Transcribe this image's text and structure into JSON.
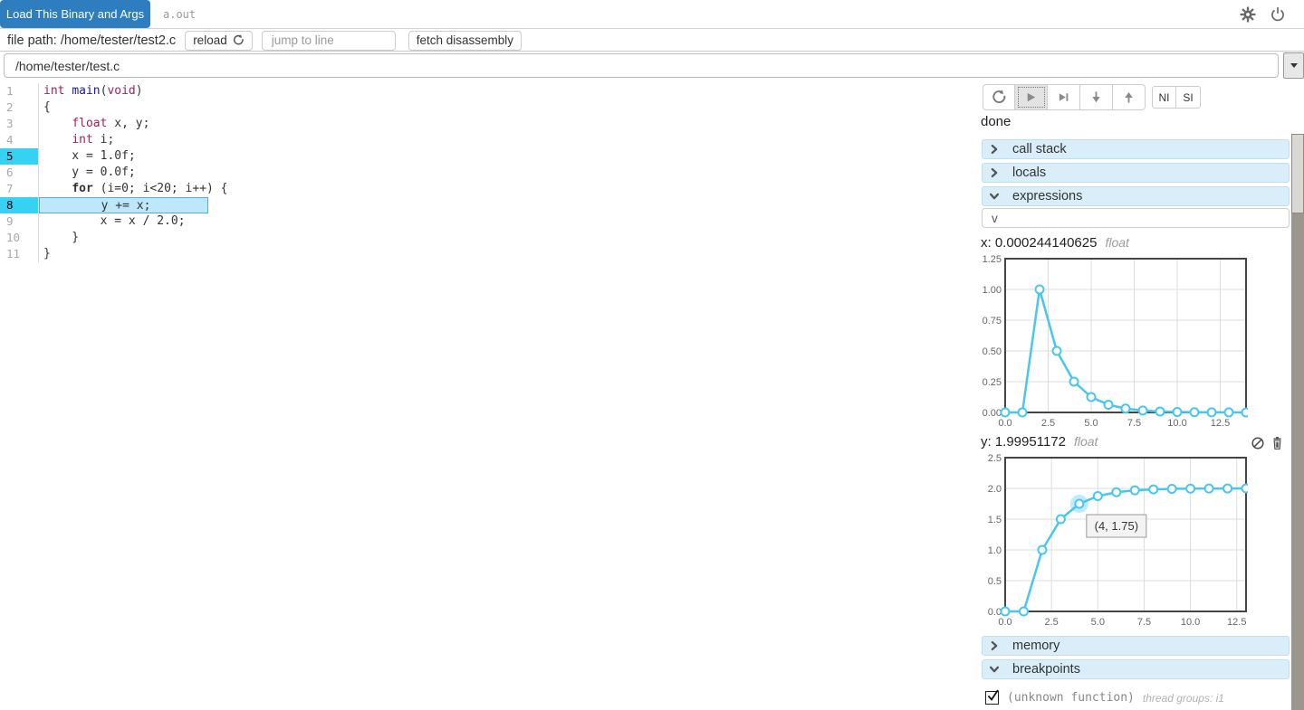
{
  "toolbar": {
    "load_button_label": "Load This Binary and Args",
    "binary_value": "a.out"
  },
  "file_bar": {
    "path_label": "file path: /home/tester/test2.c",
    "reload_button_label": "reload",
    "jump_placeholder": "jump to line",
    "fetch_button_label": "fetch disassembly"
  },
  "source_select": {
    "value": "/home/tester/test.c"
  },
  "editor": {
    "lines": [
      {
        "num": 1,
        "tokens": [
          {
            "t": "int",
            "c": "k"
          },
          {
            "t": " ",
            "c": "p"
          },
          {
            "t": "main",
            "c": "f"
          },
          {
            "t": "(",
            "c": "p"
          },
          {
            "t": "void",
            "c": "k"
          },
          {
            "t": ")",
            "c": "p"
          }
        ]
      },
      {
        "num": 2,
        "tokens": [
          {
            "t": "{",
            "c": "p"
          }
        ]
      },
      {
        "num": 3,
        "tokens": [
          {
            "t": "    ",
            "c": "p"
          },
          {
            "t": "float",
            "c": "k"
          },
          {
            "t": " x, y;",
            "c": "p"
          }
        ]
      },
      {
        "num": 4,
        "tokens": [
          {
            "t": "    ",
            "c": "p"
          },
          {
            "t": "int",
            "c": "k"
          },
          {
            "t": " i;",
            "c": "p"
          }
        ]
      },
      {
        "num": 5,
        "gutter_active": true,
        "tokens": [
          {
            "t": "    x = 1.0f;",
            "c": "p"
          }
        ]
      },
      {
        "num": 6,
        "tokens": [
          {
            "t": "    y = 0.0f;",
            "c": "p"
          }
        ]
      },
      {
        "num": 7,
        "tokens": [
          {
            "t": "    ",
            "c": "p"
          },
          {
            "t": "for",
            "c": "b"
          },
          {
            "t": " (i=0; i<20; i++) {",
            "c": "p"
          }
        ]
      },
      {
        "num": 8,
        "gutter_active": true,
        "line_active": true,
        "tokens": [
          {
            "t": "        y += x;",
            "c": "p"
          }
        ]
      },
      {
        "num": 9,
        "tokens": [
          {
            "t": "        x = x / 2.0;",
            "c": "p"
          }
        ]
      },
      {
        "num": 10,
        "tokens": [
          {
            "t": "    }",
            "c": "p"
          }
        ]
      },
      {
        "num": 11,
        "tokens": [
          {
            "t": "}",
            "c": "p"
          }
        ]
      }
    ]
  },
  "controls": {
    "status": "done",
    "ni_label": "NI",
    "si_label": "SI",
    "button_icons": [
      "refresh-icon",
      "play-icon",
      "step-over-icon",
      "step-into-icon",
      "step-out-icon"
    ]
  },
  "sections": {
    "call_stack": "call stack",
    "locals": "locals",
    "expressions": "expressions",
    "memory": "memory",
    "breakpoints": "breakpoints"
  },
  "expressions_section": {
    "input_value": "v"
  },
  "chart_data": [
    {
      "type": "line",
      "expression": "x",
      "title": "x: 0.000244140625",
      "type_label": "float",
      "x": [
        0,
        1,
        2,
        3,
        4,
        5,
        6,
        7,
        8,
        9,
        10,
        11,
        12,
        13,
        14
      ],
      "values": [
        0,
        0,
        1,
        0.5,
        0.25,
        0.125,
        0.0625,
        0.03125,
        0.015625,
        0.0078125,
        0.00390625,
        0.001953125,
        0.0009765625,
        0.00048828125,
        0.000244140625
      ],
      "xlim": [
        0,
        14
      ],
      "ylim": [
        0,
        1.25
      ],
      "xticks": [
        0,
        2.5,
        5,
        7.5,
        10,
        12.5
      ],
      "xtick_labels": [
        "0.0",
        "2.5",
        "5.0",
        "7.5",
        "10.0",
        "12.5"
      ],
      "yticks": [
        0,
        0.25,
        0.5,
        0.75,
        1,
        1.25
      ],
      "ytick_labels": [
        "0.00",
        "0.25",
        "0.50",
        "0.75",
        "1.00",
        "1.25"
      ],
      "grid": true,
      "line_color": "#47c6f2"
    },
    {
      "type": "line",
      "expression": "y",
      "title": "y: 1.99951172",
      "type_label": "float",
      "x": [
        0,
        1,
        2,
        3,
        4,
        5,
        6,
        7,
        8,
        9,
        10,
        11,
        12,
        13
      ],
      "values": [
        0,
        0,
        1,
        1.5,
        1.75,
        1.875,
        1.9375,
        1.96875,
        1.984375,
        1.9921875,
        1.99609375,
        1.998046875,
        1.9990234375,
        1.99951172
      ],
      "xlim": [
        0,
        13
      ],
      "ylim": [
        0,
        2.5
      ],
      "xticks": [
        0,
        2.5,
        5,
        7.5,
        10,
        12.5
      ],
      "xtick_labels": [
        "0.0",
        "2.5",
        "5.0",
        "7.5",
        "10.0",
        "12.5"
      ],
      "yticks": [
        0,
        0.5,
        1,
        1.5,
        2,
        2.5
      ],
      "ytick_labels": [
        "0.0",
        "0.5",
        "1.0",
        "1.5",
        "2.0",
        "2.5"
      ],
      "grid": true,
      "line_color": "#47c6f2",
      "hover": {
        "index": 4,
        "label": "(4, 1.75)"
      }
    }
  ],
  "breakpoints_section": {
    "item_label": "(unknown function)",
    "item_meta": "thread groups: i1",
    "item_checked": true
  },
  "colors": {
    "accent_blue": "#2e7dbf",
    "chart_line": "#47c6f2",
    "gutter_highlight": "#36d2f3",
    "line_highlight_bg": "#bde7fa",
    "section_header_bg": "#d9eef9",
    "keyword": "#a71d5d",
    "function_name": "#1a1aa6"
  }
}
